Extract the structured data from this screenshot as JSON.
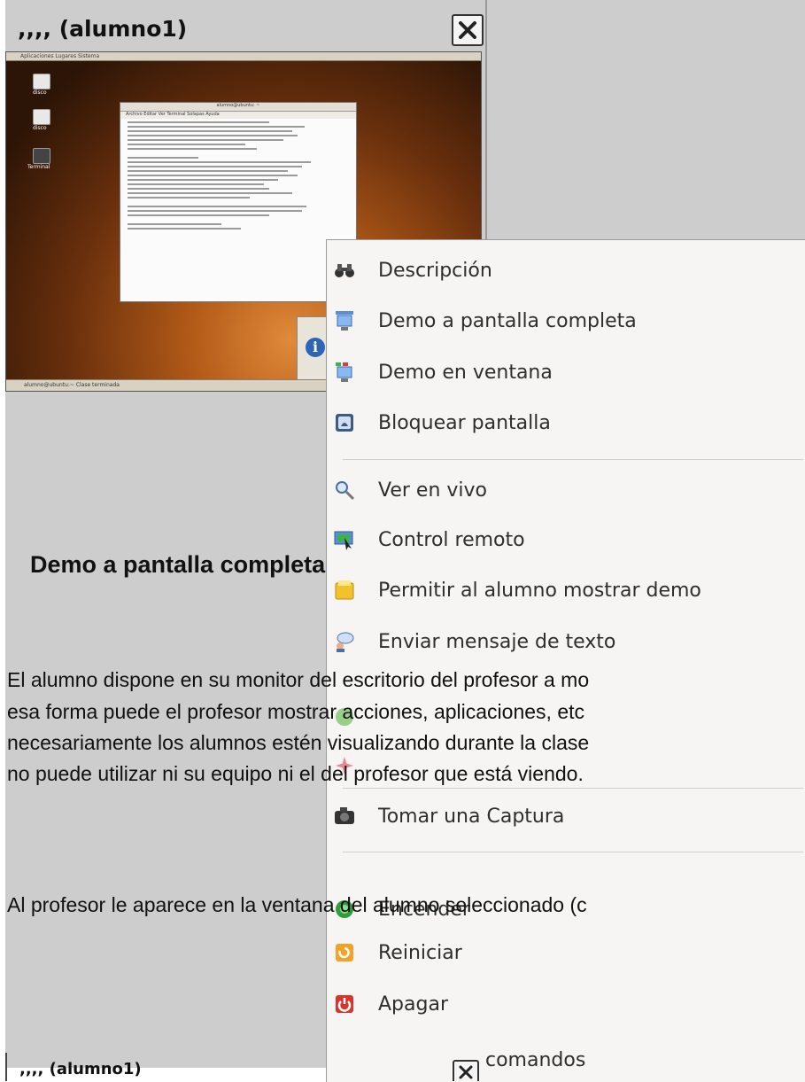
{
  "window": {
    "title": ",,,, (alumno1)",
    "close_icon": "close-x-icon"
  },
  "thumbnail": {
    "top_panel_text": "Aplicaciones  Lugares  Sistema",
    "bottom_panel_text": "alumno@ubuntu:~   Clase terminada",
    "desktop_icons": [
      "disco",
      "disco",
      "Terminal"
    ],
    "terminal_title": "alumno@ubuntu: ~",
    "terminal_menu": "Archivo  Editar  Ver  Terminal  Solapas  Ayuda"
  },
  "context_menu": {
    "items": [
      {
        "label": "Descripción",
        "icon": "binoculars-icon"
      },
      {
        "label": "Demo a pantalla completa",
        "icon": "monitor-fullscreen-icon"
      },
      {
        "label": "Demo en ventana",
        "icon": "monitor-window-icon"
      },
      {
        "label": "Bloquear pantalla",
        "icon": "lock-screen-icon"
      },
      {
        "label": "Ver en vivo",
        "icon": "magnifier-icon"
      },
      {
        "label": "Control remoto",
        "icon": "remote-control-icon"
      },
      {
        "label": "Permitir al alumno mostrar demo",
        "icon": "student-demo-icon"
      },
      {
        "label": "Enviar mensaje de texto",
        "icon": "chat-bubble-icon"
      },
      {
        "label": "Tomar una Captura",
        "icon": "camera-icon"
      },
      {
        "label": "Encender",
        "icon": "power-on-icon"
      },
      {
        "label": "Reiniciar",
        "icon": "restart-icon"
      },
      {
        "label": "Apagar",
        "icon": "power-off-icon"
      }
    ],
    "partial_items": {
      "ejecutar_tail": "comandos"
    }
  },
  "doc": {
    "heading": "Demo a pantalla completa",
    "para_line1": "El alumno dispone en su monitor del escritorio del profesor a mo",
    "para_line2": "esa forma puede el profesor mostrar acciones, aplicaciones, etc",
    "para_line3": "necesariamente los alumnos estén visualizando durante la clase",
    "para_line4": "no puede utilizar ni su equipo ni el del profesor que está viendo.",
    "para2_line1": "Al profesor le aparece en la ventana del alumno seleccionado (c"
  },
  "bottom_window": {
    "title": ",,,, (alumno1)"
  },
  "colors": {
    "background": "#cdcdcd",
    "menu_bg": "#f6f5f4",
    "desktop_orange": "#b25a18"
  }
}
